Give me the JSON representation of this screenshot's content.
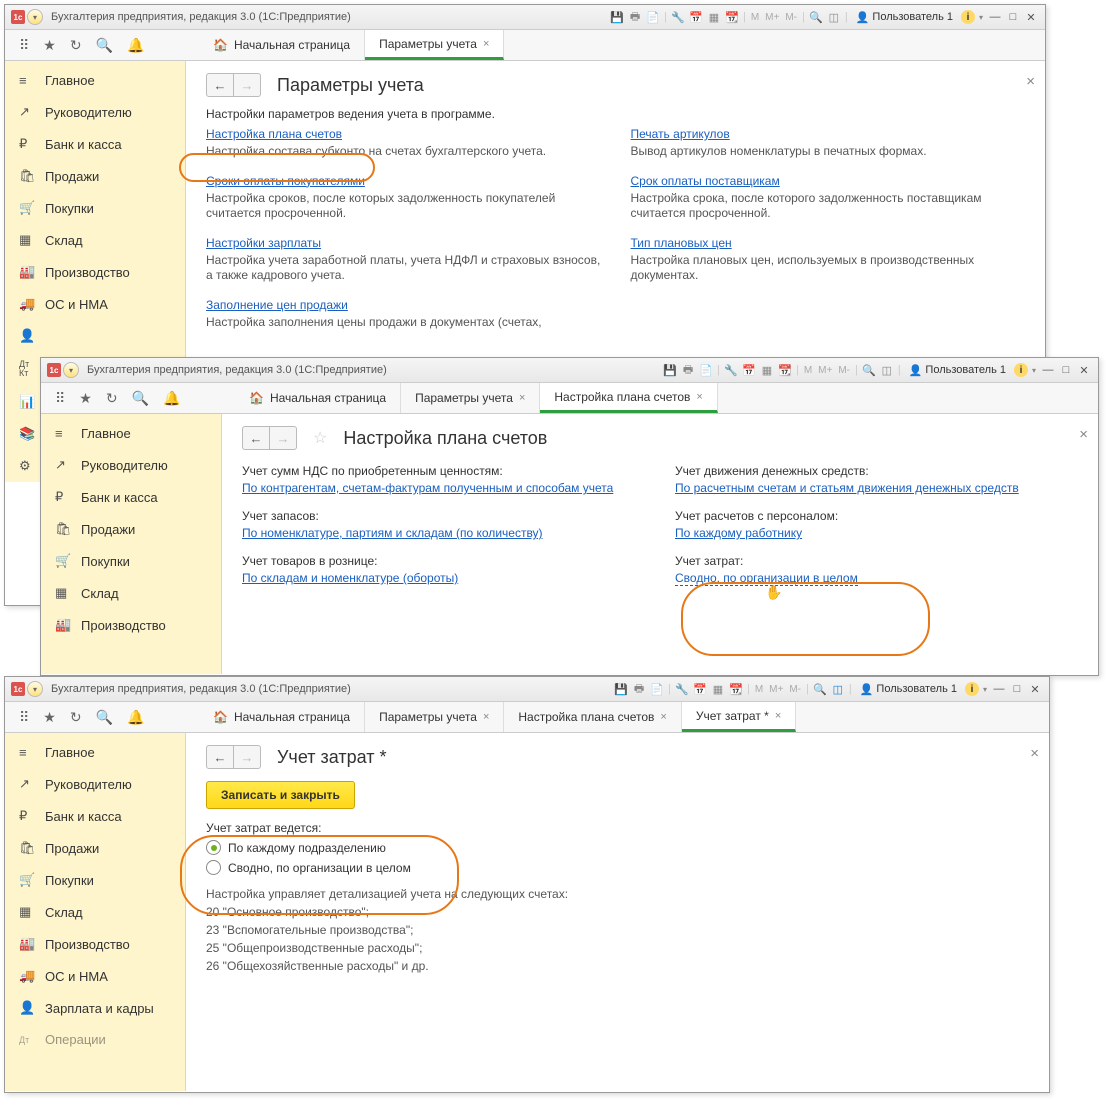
{
  "app_title": "Бухгалтерия предприятия, редакция 3.0  (1С:Предприятие)",
  "user": "Пользователь 1",
  "menu_m": [
    "М",
    "М+",
    "М-"
  ],
  "tabs_home": "Начальная страница",
  "sidebar": [
    {
      "icon": "≡",
      "label": "Главное"
    },
    {
      "icon": "↗",
      "label": "Руководителю"
    },
    {
      "icon": "₽",
      "label": "Банк и касса"
    },
    {
      "icon": "🛍",
      "label": "Продажи"
    },
    {
      "icon": "🛒",
      "label": "Покупки"
    },
    {
      "icon": "▦",
      "label": "Склад"
    },
    {
      "icon": "🏭",
      "label": "Производство"
    },
    {
      "icon": "🚚",
      "label": "ОС и НМА"
    },
    {
      "icon": "👤",
      "label": ""
    },
    {
      "icon": "Дт Кт",
      "label": ""
    },
    {
      "icon": "📊",
      "label": ""
    },
    {
      "icon": "📚",
      "label": ""
    },
    {
      "icon": "⚙",
      "label": ""
    }
  ],
  "sidebar3_extra": [
    {
      "icon": "👤",
      "label": "Зарплата и кадры"
    },
    {
      "icon": "Дт",
      "label": "Операции"
    }
  ],
  "win1": {
    "tab_active": "Параметры учета",
    "title": "Параметры учета",
    "intro": "Настройки параметров ведения учета в программе.",
    "left": [
      {
        "link": "Настройка плана счетов",
        "desc": "Настройка состава субконто на счетах бухгалтерского учета."
      },
      {
        "link": "Сроки оплаты покупателями",
        "desc": "Настройка сроков, после которых задолженность покупателей считается просроченной."
      },
      {
        "link": "Настройки зарплаты",
        "desc": "Настройка учета заработной платы, учета НДФЛ и страховых взносов, а также кадрового учета."
      },
      {
        "link": "Заполнение цен продажи",
        "desc": "Настройка заполнения цены продажи в документах (счетах,"
      }
    ],
    "right": [
      {
        "link": "Печать артикулов",
        "desc": "Вывод артикулов номенклатуры в печатных формах."
      },
      {
        "link": "Срок оплаты поставщикам",
        "desc": "Настройка срока, после которого задолженность поставщикам считается просроченной."
      },
      {
        "link": "Тип плановых цен",
        "desc": "Настройка плановых цен, используемых в производственных документах."
      }
    ]
  },
  "win2": {
    "tabs": [
      "Параметры учета",
      "Настройка плана счетов"
    ],
    "title": "Настройка плана счетов",
    "left": [
      {
        "label": "Учет сумм НДС по приобретенным ценностям:",
        "link": "По контрагентам, счетам-фактурам полученным и способам учета"
      },
      {
        "label": "Учет запасов:",
        "link": "По номенклатуре, партиям и складам (по количеству)"
      },
      {
        "label": "Учет товаров в рознице:",
        "link": "По складам и номенклатуре (обороты)"
      }
    ],
    "right": [
      {
        "label": "Учет движения денежных средств:",
        "link": "По расчетным счетам и статьям движения денежных средств"
      },
      {
        "label": "Учет расчетов с персоналом:",
        "link": "По каждому работнику"
      },
      {
        "label": "Учет затрат:",
        "link": "Сводно, по организации в целом"
      }
    ]
  },
  "win3": {
    "tabs": [
      "Параметры учета",
      "Настройка плана счетов",
      "Учет затрат *"
    ],
    "title": "Учет затрат *",
    "save_btn": "Записать и закрыть",
    "section_label": "Учет затрат ведется:",
    "opt1": "По каждому подразделению",
    "opt2": "Сводно, по организации в целом",
    "note_lead": "Настройка управляет детализацией учета на следующих счетах:",
    "note_lines": [
      "20 \"Основное производство\";",
      "23 \"Вспомогательные производства\";",
      "25 \"Общепроизводственные расходы\";",
      "26 \"Общехозяйственные расходы\" и др."
    ]
  }
}
